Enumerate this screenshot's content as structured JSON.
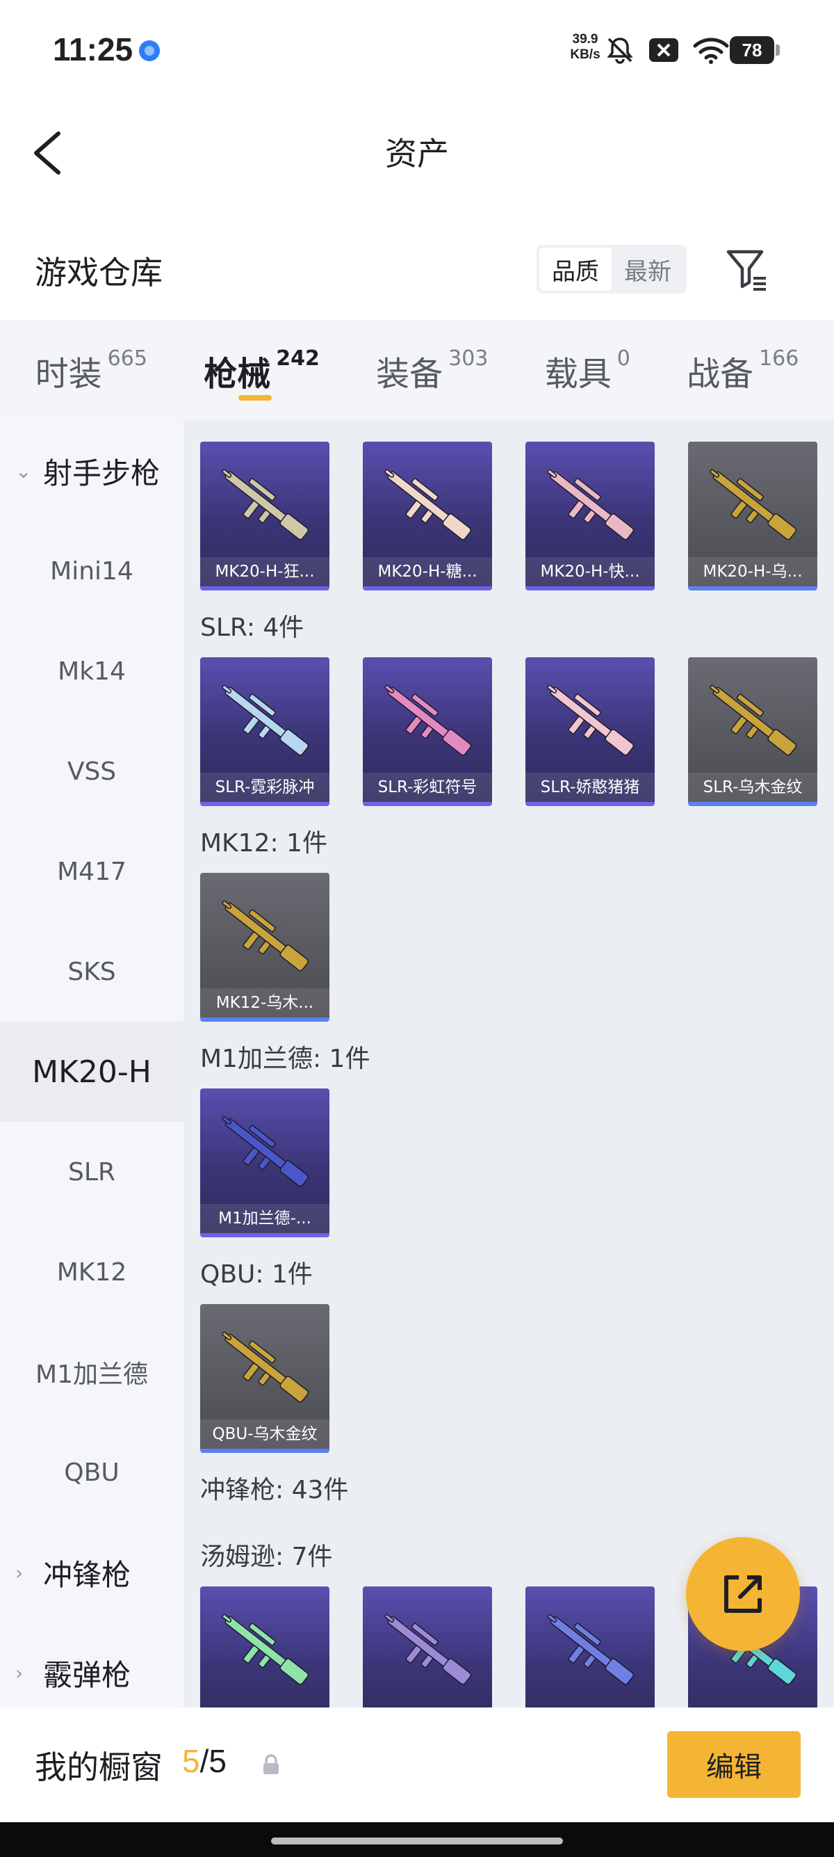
{
  "status_bar": {
    "time": "11:25",
    "speed_value": "39.9",
    "speed_unit": "KB/s",
    "battery": "78"
  },
  "header": {
    "title": "资产"
  },
  "warehouse": {
    "title": "游戏仓库",
    "sort_options": [
      "品质",
      "最新"
    ]
  },
  "category_tabs": [
    {
      "label": "时装",
      "count": "665"
    },
    {
      "label": "枪械",
      "count": "242"
    },
    {
      "label": "装备",
      "count": "303"
    },
    {
      "label": "载具",
      "count": "0"
    },
    {
      "label": "战备",
      "count": "166"
    }
  ],
  "sidebar": {
    "items": [
      {
        "label": "射手步枪"
      },
      {
        "label": "Mini14"
      },
      {
        "label": "Mk14"
      },
      {
        "label": "VSS"
      },
      {
        "label": "M417"
      },
      {
        "label": "SKS"
      },
      {
        "label": "MK20-H"
      },
      {
        "label": "SLR"
      },
      {
        "label": "MK12"
      },
      {
        "label": "M1加兰德"
      },
      {
        "label": "QBU"
      },
      {
        "label": "冲锋枪"
      },
      {
        "label": "霰弹枪"
      }
    ]
  },
  "sections": {
    "mk20": {
      "items": [
        {
          "name": "MK20-H-狂...",
          "rarity": "purple",
          "color": "#cfc7a8"
        },
        {
          "name": "MK20-H-糖...",
          "rarity": "purple",
          "color": "#f0d7c8"
        },
        {
          "name": "MK20-H-快...",
          "rarity": "purple",
          "color": "#e9b8c6"
        },
        {
          "name": "MK20-H-乌...",
          "rarity": "gray",
          "color": "#c9a43a"
        }
      ]
    },
    "slr": {
      "label": "SLR: 4件",
      "items": [
        {
          "name": "SLR-霓彩脉冲",
          "rarity": "purple",
          "color": "#b8d6f0"
        },
        {
          "name": "SLR-彩虹符号",
          "rarity": "purple",
          "color": "#e48ac2"
        },
        {
          "name": "SLR-娇憨猪猪",
          "rarity": "purple",
          "color": "#f1c6cf"
        },
        {
          "name": "SLR-乌木金纹",
          "rarity": "gray",
          "color": "#c9a43a"
        }
      ]
    },
    "mk12": {
      "label": "MK12: 1件",
      "items": [
        {
          "name": "MK12-乌木...",
          "rarity": "gray",
          "color": "#c9a43a"
        }
      ]
    },
    "m1": {
      "label": "M1加兰德: 1件",
      "items": [
        {
          "name": "M1加兰德-...",
          "rarity": "purple",
          "color": "#4a57c8"
        }
      ]
    },
    "qbu": {
      "label": "QBU: 1件",
      "items": [
        {
          "name": "QBU-乌木金纹",
          "rarity": "gray",
          "color": "#c9a43a"
        }
      ]
    },
    "smg": {
      "label": "冲锋枪: 43件"
    },
    "thompson": {
      "label": "汤姆逊: 7件",
      "items": [
        {
          "name": "",
          "rarity": "purple",
          "color": "#8fe3a8"
        },
        {
          "name": "",
          "rarity": "purple",
          "color": "#9c8ad8"
        },
        {
          "name": "",
          "rarity": "purple",
          "color": "#6f7fe4"
        },
        {
          "name": "",
          "rarity": "purple",
          "color": "#5fd6d8"
        }
      ]
    }
  },
  "bottom_bar": {
    "label": "我的橱窗",
    "count_current": "5",
    "count_total": "/5",
    "edit_label": "编辑"
  },
  "colors": {
    "accent": "#f4b534",
    "purple_rarity": "#6b63e8",
    "gray_rarity": "#5a82f0"
  }
}
